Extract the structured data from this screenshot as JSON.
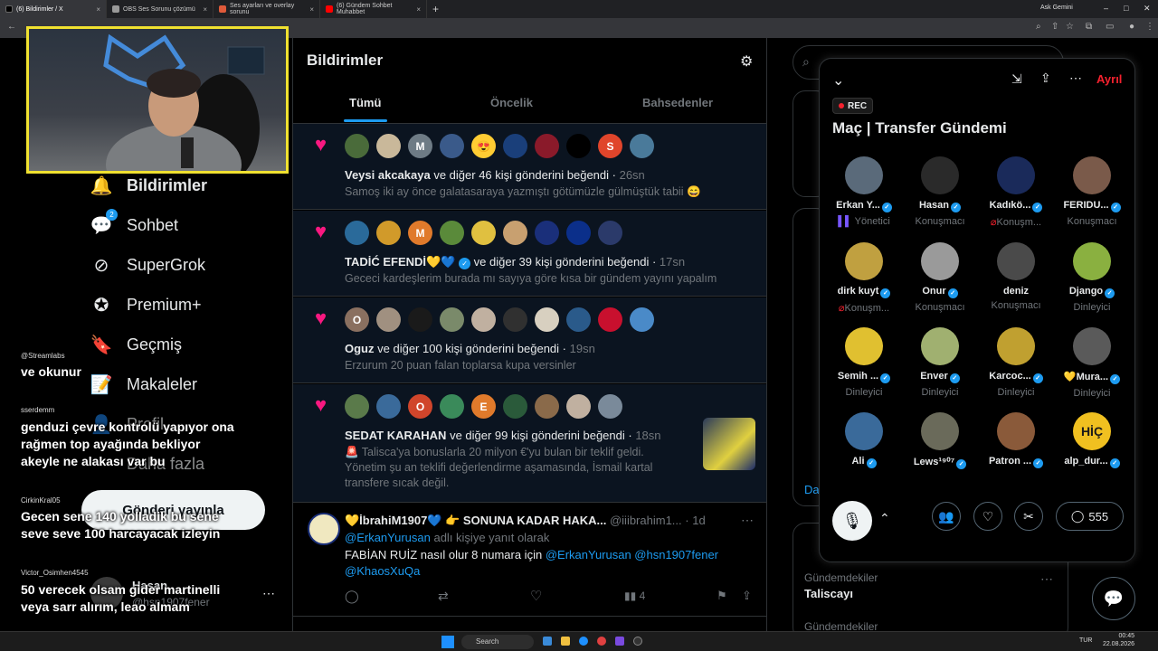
{
  "browser": {
    "tabs": [
      {
        "title": "(6) Bildirimler / X",
        "color": "#000000"
      },
      {
        "title": "OBS Ses Sorunu çözümü",
        "color": "#999999"
      },
      {
        "title": "Ses ayarları ve overlay sorunu",
        "color": "#e05a3a"
      },
      {
        "title": "(6) Gündem Sohbet Muhabbet",
        "color": "#ff0000"
      }
    ],
    "ask_gemini": "Ask Gemini"
  },
  "nav": {
    "items": [
      {
        "label": "Bildirimler",
        "icon": "bell-icon",
        "badge": ""
      },
      {
        "label": "Sohbet",
        "icon": "chat-icon",
        "badge": "2"
      },
      {
        "label": "SuperGrok",
        "icon": "grok-icon",
        "badge": ""
      },
      {
        "label": "Premium+",
        "icon": "premium-icon",
        "badge": ""
      },
      {
        "label": "Geçmiş",
        "icon": "bookmark-icon",
        "badge": ""
      },
      {
        "label": "Makaleler",
        "icon": "article-icon",
        "badge": ""
      },
      {
        "label": "Profil",
        "icon": "profile-icon",
        "badge": ""
      },
      {
        "label": "Daha fazla",
        "icon": "more-icon",
        "badge": ""
      }
    ],
    "post_button": "Gönderi yayınla",
    "account": {
      "name": "Hasan",
      "handle": "@hsn1907fener"
    }
  },
  "chat_overlay": [
    {
      "user": "@Streamlabs",
      "text": "ve okunur"
    },
    {
      "user": "sserdemm",
      "text": "genduzi çevre kontrolü yapıyor ona rağmen top ayağında bekliyor akeyle ne alakası var bu"
    },
    {
      "user": "CirkinKral05",
      "text": "Gecen sene 140 yolladik bu sene seve seve 100 harcayacak izleyin"
    },
    {
      "user": "Victor_Osimhen4545",
      "text": "50 verecek olsam gider martinelli veya sarr alırım, leao almam"
    }
  ],
  "main": {
    "title": "Bildirimler",
    "tabs": [
      "Tümü",
      "Öncelik",
      "Bahsedenler"
    ],
    "notifications": [
      {
        "avatars": [
          "",
          "",
          "M",
          "",
          "😍",
          "",
          "",
          "",
          "S",
          ""
        ],
        "colors": [
          "#4a6b3a",
          "#c9b89a",
          "#6e7b85",
          "#3a5a8a",
          "#ffcc33",
          "#1a3f7a",
          "#8a1a2a",
          "#000000",
          "#e0452b",
          "#4a7a9a"
        ],
        "name": "Veysi akcakaya",
        "verified": false,
        "action": "ve diğer 46 kişi gönderini beğendi",
        "time": "26sn",
        "text": "Samoş iki ay önce galatasaraya yazmıştı götümüzle gülmüştük tabii 😄"
      },
      {
        "avatars": [
          "",
          "",
          "M",
          "",
          "",
          "",
          "",
          "",
          ""
        ],
        "colors": [
          "#2a6a9a",
          "#d19a2a",
          "#e07a2b",
          "#5a8a3a",
          "#e0c040",
          "#c8a070",
          "#1a2f7a",
          "#0b2f8a",
          "#2b3a6a"
        ],
        "name": "TADİĆ EFENDİ💛💙",
        "verified": true,
        "action": "ve diğer 39 kişi gönderini beğendi",
        "time": "17sn",
        "text": "Gececi kardeşlerim burada mı sayıya göre kısa bir gündem yayını yapalım"
      },
      {
        "avatars": [
          "O",
          "",
          "",
          "",
          "",
          "",
          "",
          "",
          "",
          ""
        ],
        "colors": [
          "#8a7060",
          "#a09080",
          "#1a1a1a",
          "#7a8a6a",
          "#c0b0a0",
          "#303030",
          "#d8d0c0",
          "#2a5a8a",
          "#c8102e",
          "#4a8ac8"
        ],
        "name": "Oguz",
        "verified": false,
        "action": "ve diğer 100 kişi gönderini beğendi",
        "time": "19sn",
        "text": "Erzurum 20 puan falan toplarsa kupa versinler"
      },
      {
        "avatars": [
          "",
          "",
          "O",
          "",
          "E",
          "",
          "",
          "",
          ""
        ],
        "colors": [
          "#5a7a4a",
          "#3a6a9a",
          "#d0452b",
          "#3a8a5a",
          "#e07a2b",
          "#2a5a3a",
          "#8a6a4a",
          "#c0b0a0",
          "#7a8a9a"
        ],
        "name": "SEDAT KARAHAN",
        "verified": false,
        "action": "ve diğer 99 kişi gönderini beğendi",
        "time": "18sn",
        "text": "🚨 Talisca'ya bonuslarla 20 milyon €'yu bulan bir teklif geldi. Yönetim şu an teklifi değerlendirme aşamasında, İsmail kartal transfere sıcak değil."
      }
    ],
    "tweet": {
      "name": "💛İbrahiM1907💙 👉 SONUNA KADAR HAKA...",
      "handle": "@iiibrahim1...",
      "time": "1d",
      "reply_to_prefix": "@ErkanYurusan",
      "reply_to_suffix": " adlı kişiye yanıt olarak",
      "text": "FABİAN RUİZ nasıl olur 8 numara için",
      "mentions": "@ErkanYurusan @hsn1907fener",
      "mention2": "@KhaosXuQa",
      "views": "4"
    }
  },
  "sidebar": {
    "trend_category": "Gündemdekiler",
    "trend_name": "Taliscayı",
    "trend_category2": "Gündemdekiler",
    "more_link": "Da"
  },
  "space": {
    "rec_label": "REC",
    "title": "Maç | Transfer Gündemi",
    "leave": "Ayrıl",
    "speakers": [
      {
        "name": "Erkan Y...",
        "role": "Yönetici",
        "verified": true,
        "color": "#5a6a7a"
      },
      {
        "name": "Hasan",
        "role": "Konuşmacı",
        "verified": true,
        "color": "#2a2a2a"
      },
      {
        "name": "Kadıkö...",
        "role": "Konuşm...",
        "verified": true,
        "color": "#1a2a5a"
      },
      {
        "name": "FERIDU...",
        "role": "Konuşmacı",
        "verified": true,
        "color": "#7a5a4a"
      },
      {
        "name": "dirk kuyt",
        "role": "Konuşm...",
        "verified": true,
        "color": "#c0a040"
      },
      {
        "name": "Onur",
        "role": "Konuşmacı",
        "verified": true,
        "color": "#9a9a9a"
      },
      {
        "name": "deniz",
        "role": "Konuşmacı",
        "verified": false,
        "color": "#4a4a4a"
      },
      {
        "name": "Django",
        "role": "Dinleyici",
        "verified": true,
        "color": "#8ab040"
      },
      {
        "name": "Semih ...",
        "role": "Dinleyici",
        "verified": true,
        "color": "#e0c030"
      },
      {
        "name": "Enver",
        "role": "Dinleyici",
        "verified": true,
        "color": "#a0b070"
      },
      {
        "name": "Karcoc...",
        "role": "Dinleyici",
        "verified": true,
        "color": "#c0a030"
      },
      {
        "name": "💛Mura...",
        "role": "Dinleyici",
        "verified": true,
        "color": "#5a5a5a"
      },
      {
        "name": "Ali",
        "role": "",
        "verified": true,
        "color": "#3a6a9a"
      },
      {
        "name": "Lews¹⁹⁰⁷",
        "role": "",
        "verified": true,
        "color": "#6a6a5a"
      },
      {
        "name": "Patron ...",
        "role": "",
        "verified": true,
        "color": "#8a5a3a"
      },
      {
        "name": "alp_dur...",
        "role": "",
        "verified": true,
        "color": "#f0c020"
      }
    ],
    "hic_text": "HİÇ",
    "comment_count": "555"
  },
  "taskbar": {
    "search_placeholder": "Search",
    "lang": "TUR",
    "time": "00:45",
    "date": "22.08.2026"
  }
}
